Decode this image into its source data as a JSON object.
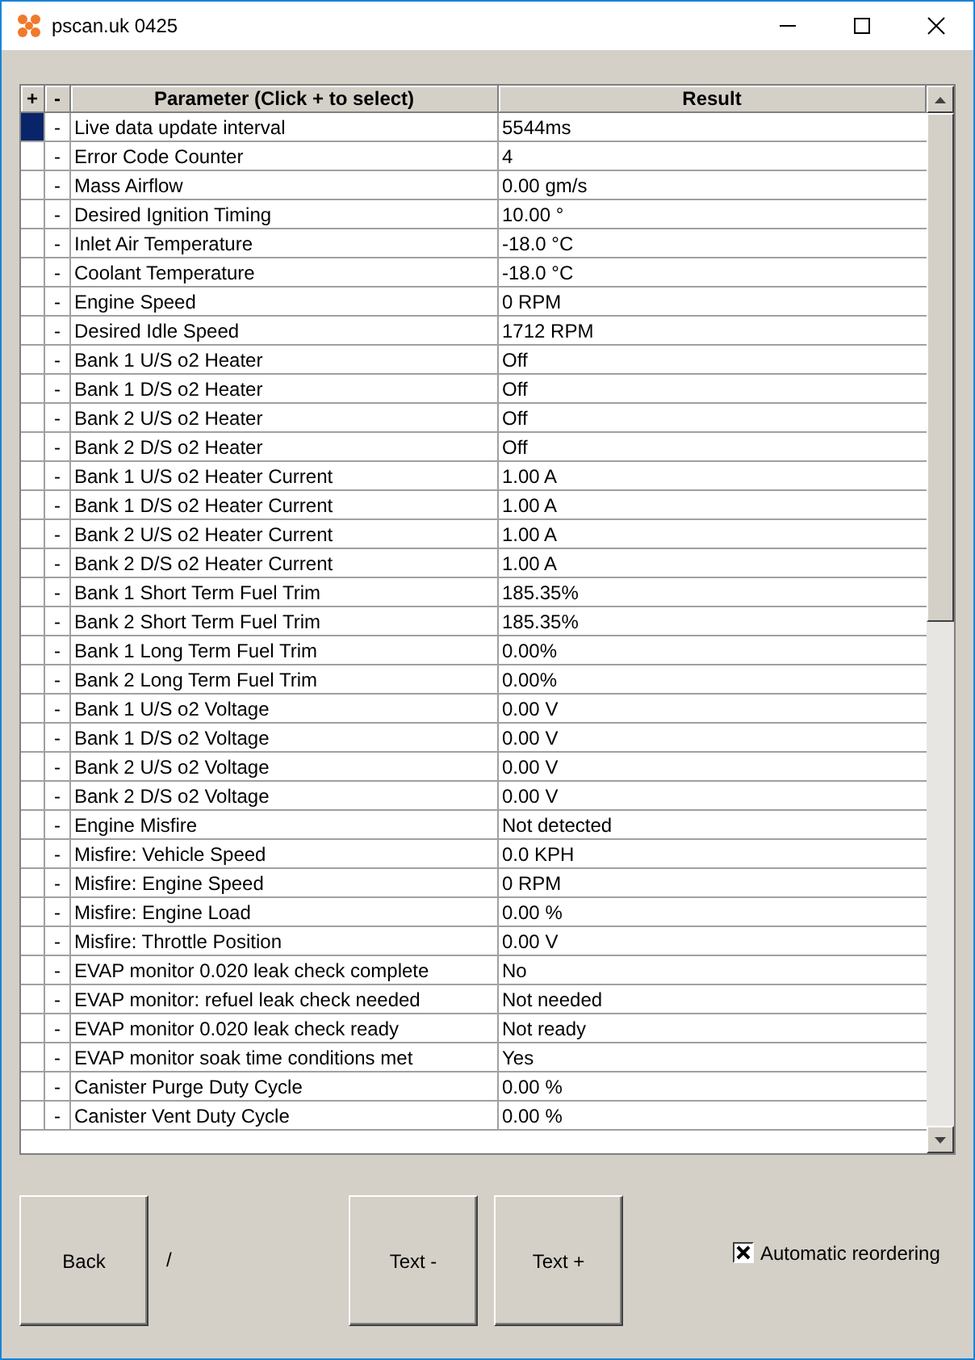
{
  "window": {
    "title": "pscan.uk 0425"
  },
  "table": {
    "columns": [
      "+",
      "-",
      "Parameter (Click + to select)",
      "Result"
    ],
    "rows": [
      {
        "selected": true,
        "minus": "-",
        "parameter": "Live data update interval",
        "result": "5544ms"
      },
      {
        "selected": false,
        "minus": "-",
        "parameter": "Error Code Counter",
        "result": "4"
      },
      {
        "selected": false,
        "minus": "-",
        "parameter": "Mass Airflow",
        "result": "0.00 gm/s"
      },
      {
        "selected": false,
        "minus": "-",
        "parameter": "Desired Ignition Timing",
        "result": "10.00 °"
      },
      {
        "selected": false,
        "minus": "-",
        "parameter": "Inlet Air Temperature",
        "result": "-18.0 °C"
      },
      {
        "selected": false,
        "minus": "-",
        "parameter": "Coolant Temperature",
        "result": "-18.0 °C"
      },
      {
        "selected": false,
        "minus": "-",
        "parameter": "Engine Speed",
        "result": "0 RPM"
      },
      {
        "selected": false,
        "minus": "-",
        "parameter": "Desired Idle Speed",
        "result": "1712 RPM"
      },
      {
        "selected": false,
        "minus": "-",
        "parameter": "Bank 1 U/S o2 Heater",
        "result": "Off"
      },
      {
        "selected": false,
        "minus": "-",
        "parameter": "Bank 1 D/S o2 Heater",
        "result": "Off"
      },
      {
        "selected": false,
        "minus": "-",
        "parameter": "Bank 2 U/S o2 Heater",
        "result": "Off"
      },
      {
        "selected": false,
        "minus": "-",
        "parameter": "Bank 2 D/S o2 Heater",
        "result": "Off"
      },
      {
        "selected": false,
        "minus": "-",
        "parameter": "Bank 1 U/S o2 Heater Current",
        "result": "1.00 A"
      },
      {
        "selected": false,
        "minus": "-",
        "parameter": "Bank 1 D/S o2 Heater Current",
        "result": "1.00 A"
      },
      {
        "selected": false,
        "minus": "-",
        "parameter": "Bank 2 U/S o2 Heater Current",
        "result": "1.00 A"
      },
      {
        "selected": false,
        "minus": "-",
        "parameter": "Bank 2 D/S o2 Heater Current",
        "result": "1.00 A"
      },
      {
        "selected": false,
        "minus": "-",
        "parameter": "Bank 1 Short Term Fuel Trim",
        "result": "185.35%"
      },
      {
        "selected": false,
        "minus": "-",
        "parameter": "Bank 2 Short Term Fuel Trim",
        "result": "185.35%"
      },
      {
        "selected": false,
        "minus": "-",
        "parameter": "Bank 1 Long Term Fuel Trim",
        "result": "0.00%"
      },
      {
        "selected": false,
        "minus": "-",
        "parameter": "Bank 2 Long Term Fuel Trim",
        "result": "0.00%"
      },
      {
        "selected": false,
        "minus": "-",
        "parameter": "Bank 1 U/S o2 Voltage",
        "result": "0.00 V"
      },
      {
        "selected": false,
        "minus": "-",
        "parameter": "Bank 1 D/S o2 Voltage",
        "result": "0.00 V"
      },
      {
        "selected": false,
        "minus": "-",
        "parameter": "Bank 2 U/S o2 Voltage",
        "result": "0.00 V"
      },
      {
        "selected": false,
        "minus": "-",
        "parameter": "Bank 2 D/S o2 Voltage",
        "result": "0.00 V"
      },
      {
        "selected": false,
        "minus": "-",
        "parameter": "Engine Misfire",
        "result": "Not detected"
      },
      {
        "selected": false,
        "minus": "-",
        "parameter": "Misfire: Vehicle Speed",
        "result": "0.0 KPH"
      },
      {
        "selected": false,
        "minus": "-",
        "parameter": "Misfire: Engine Speed",
        "result": "0 RPM"
      },
      {
        "selected": false,
        "minus": "-",
        "parameter": "Misfire: Engine Load",
        "result": "0.00 %"
      },
      {
        "selected": false,
        "minus": "-",
        "parameter": "Misfire: Throttle Position",
        "result": "0.00 V"
      },
      {
        "selected": false,
        "minus": "-",
        "parameter": "EVAP monitor 0.020 leak check complete",
        "result": "No"
      },
      {
        "selected": false,
        "minus": "-",
        "parameter": "EVAP monitor: refuel leak check needed",
        "result": "Not needed"
      },
      {
        "selected": false,
        "minus": "-",
        "parameter": "EVAP monitor 0.020 leak check ready",
        "result": "Not ready"
      },
      {
        "selected": false,
        "minus": "-",
        "parameter": "EVAP monitor soak time conditions met",
        "result": "Yes"
      },
      {
        "selected": false,
        "minus": "-",
        "parameter": "Canister Purge Duty Cycle",
        "result": "0.00 %"
      },
      {
        "selected": false,
        "minus": "-",
        "parameter": "Canister Vent Duty Cycle",
        "result": "0.00 %"
      }
    ]
  },
  "buttons": {
    "back": "Back",
    "page": "/",
    "text_minus": "Text -",
    "text_plus": "Text +"
  },
  "auto_reorder": {
    "label": "Automatic reordering",
    "checked": true
  }
}
